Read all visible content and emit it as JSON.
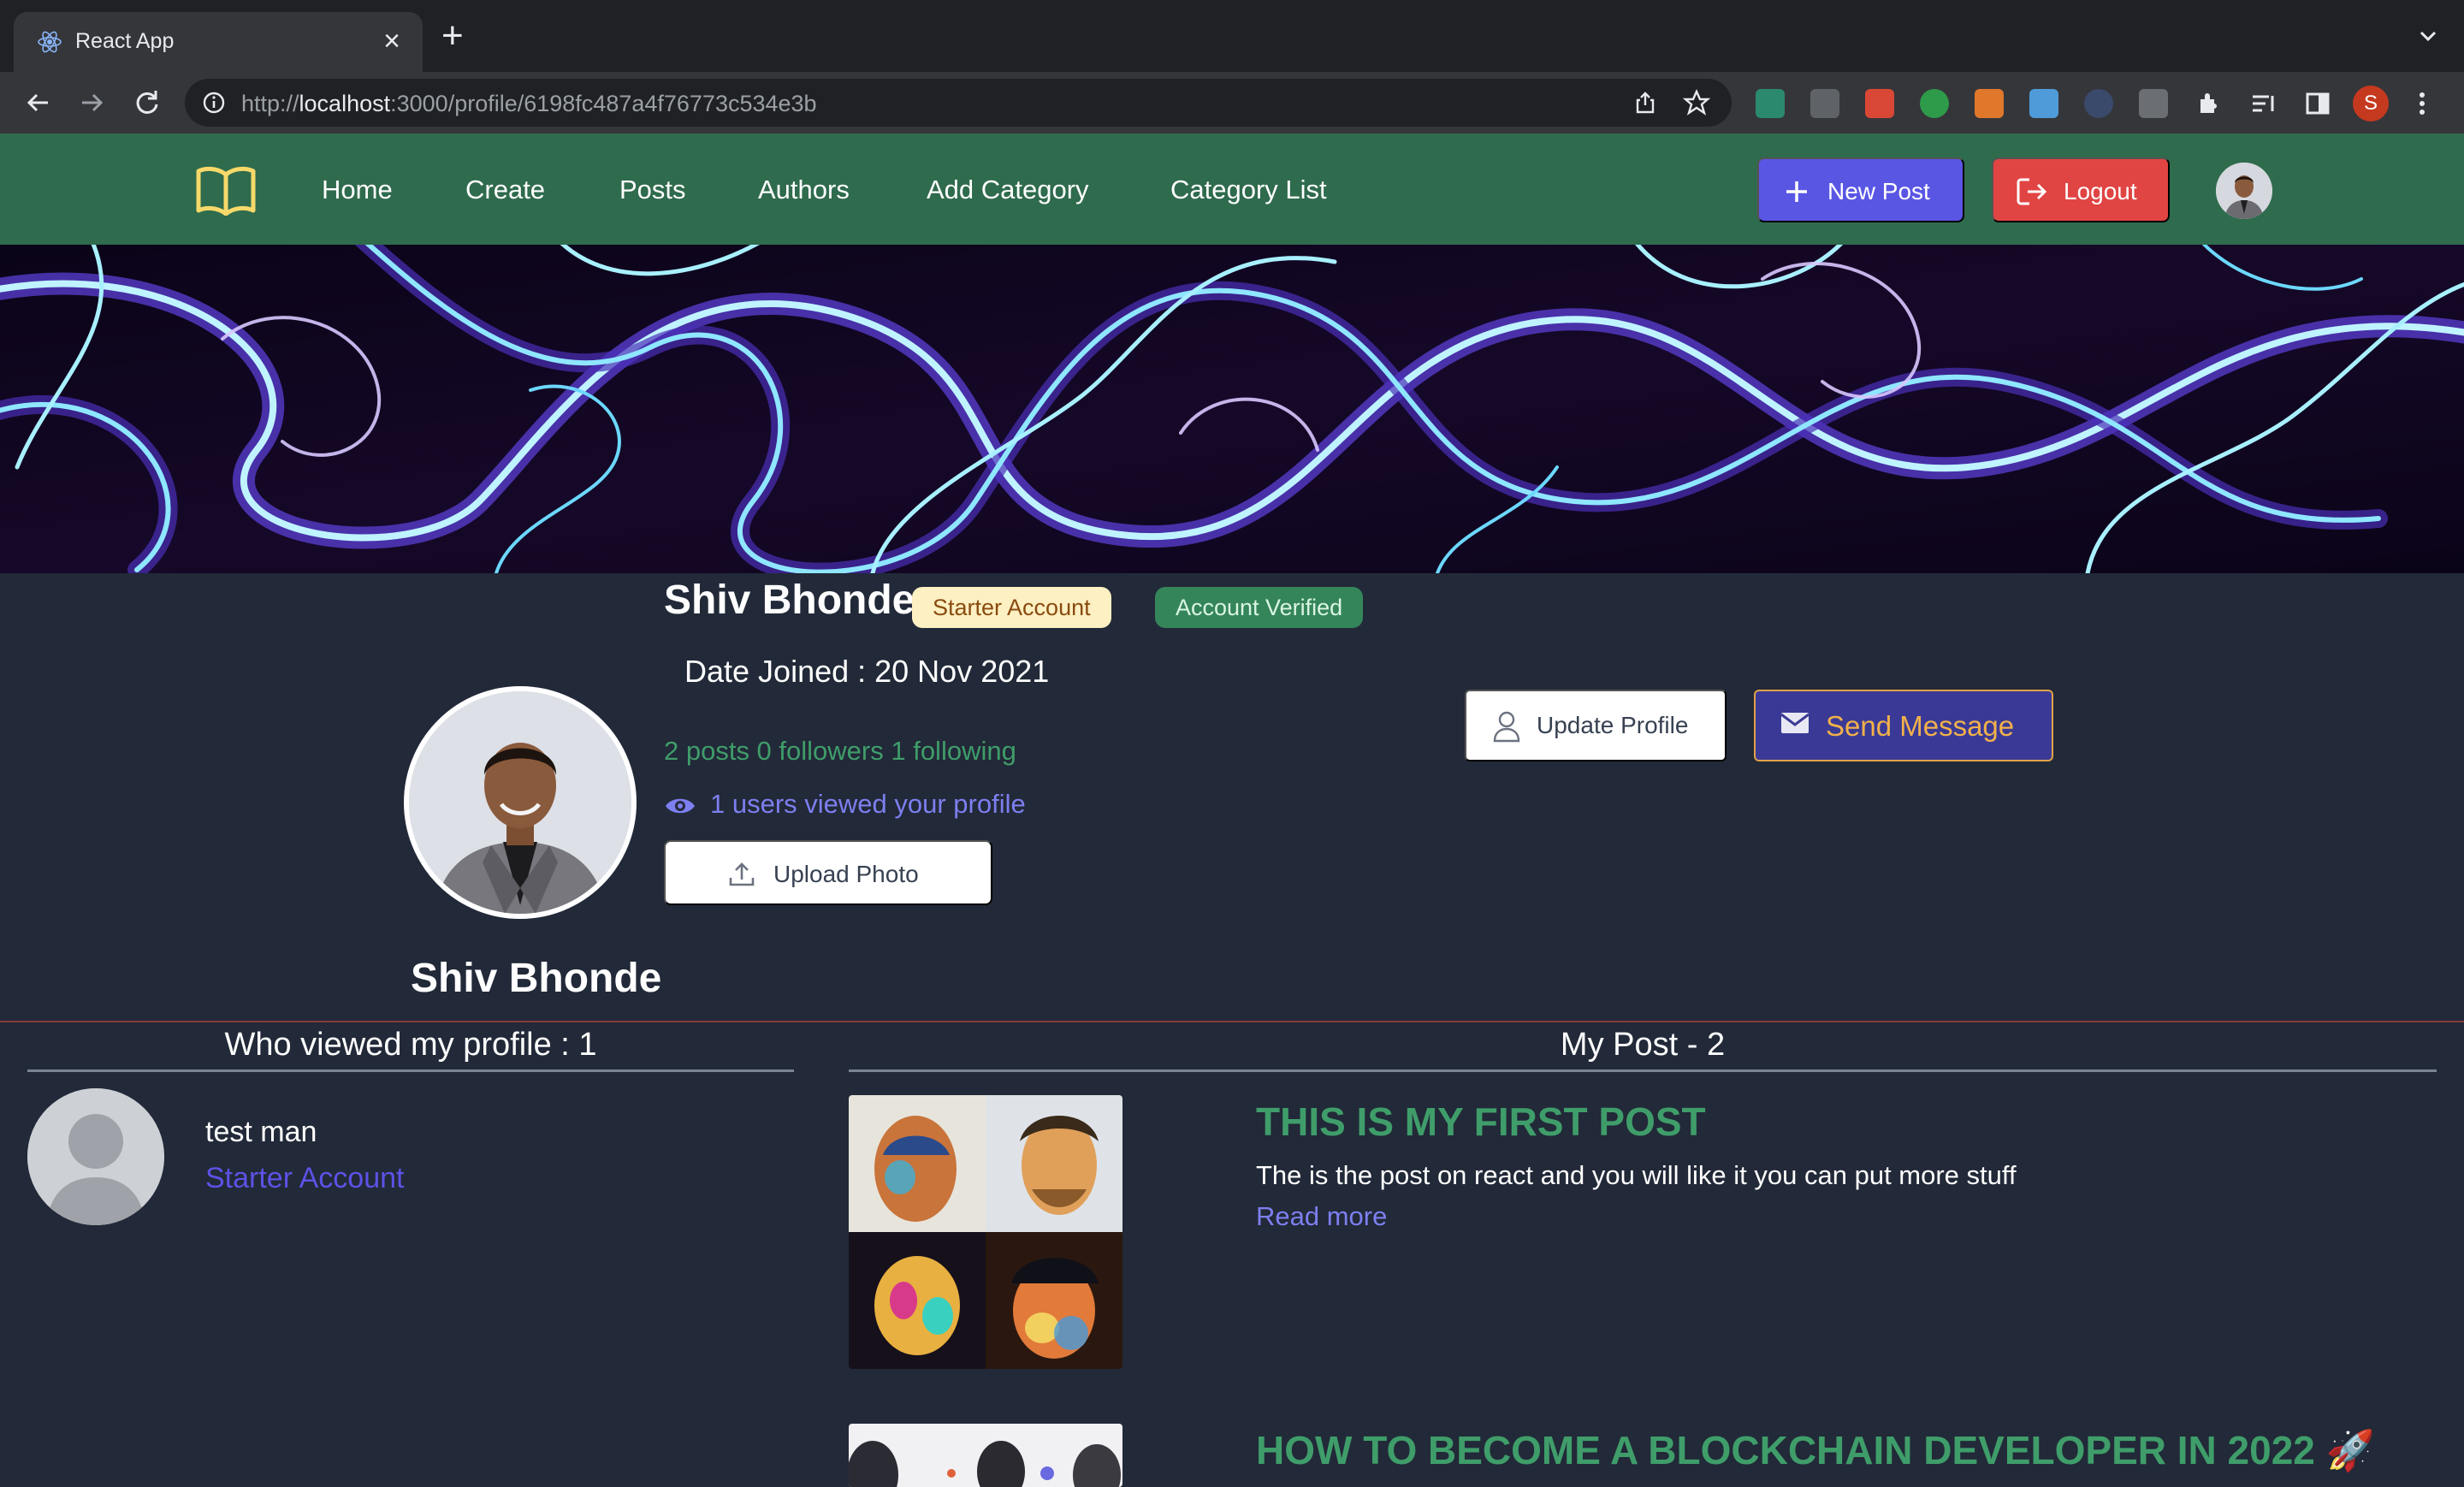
{
  "browser": {
    "tab_title": "React App",
    "url_prefix": "http://",
    "url_host": "localhost",
    "url_rest": ":3000/profile/6198fc487a4f76773c534e3b",
    "profile_initial": "S"
  },
  "nav": {
    "links": [
      "Home",
      "Create",
      "Posts",
      "Authors",
      "Add Category",
      "Category List"
    ],
    "new_post": "New Post",
    "logout": "Logout"
  },
  "profile": {
    "name": "Shiv Bhonde",
    "account_badge": "Starter Account",
    "verified_badge": "Account Verified",
    "date_joined": "Date Joined : 20 Nov 2021",
    "stats": "2 posts 0 followers 1 following",
    "viewed_text": "1 users viewed your profile",
    "upload_photo": "Upload Photo",
    "update_profile": "Update Profile",
    "send_message": "Send Message"
  },
  "viewers": {
    "title": "Who viewed my profile : 1",
    "items": [
      {
        "name": "test man",
        "account": "Starter Account"
      }
    ]
  },
  "posts": {
    "title": "My Post - 2",
    "items": [
      {
        "title": "THIS IS MY FIRST POST",
        "description": "The is the post on react and you will like it you can put more stuff",
        "read_more": "Read more"
      },
      {
        "title": "HOW TO BECOME A BLOCKCHAIN DEVELOPER IN 2022 🚀"
      }
    ]
  },
  "colors": {
    "nav_bg": "#2f6b4d",
    "page_bg": "#222938",
    "accent_green": "#3f9d6a",
    "accent_indigo": "#5a56e4",
    "danger": "#e04543"
  }
}
